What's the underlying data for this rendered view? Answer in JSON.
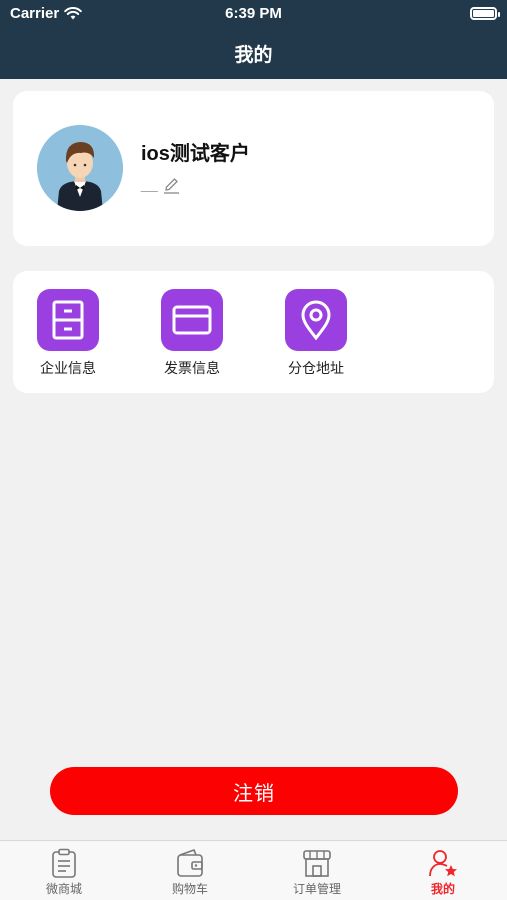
{
  "status_bar": {
    "carrier": "Carrier",
    "time": "6:39 PM"
  },
  "header": {
    "title": "我的"
  },
  "profile": {
    "name": "ios测试客户",
    "subtitle": "__"
  },
  "menu": {
    "items": [
      {
        "label": "企业信息",
        "icon": "cabinet-icon"
      },
      {
        "label": "发票信息",
        "icon": "card-icon"
      },
      {
        "label": "分仓地址",
        "icon": "location-pin-icon"
      }
    ]
  },
  "logout": {
    "label": "注销"
  },
  "tabbar": {
    "items": [
      {
        "label": "微商城",
        "icon": "clipboard-icon"
      },
      {
        "label": "购物车",
        "icon": "wallet-icon"
      },
      {
        "label": "订单管理",
        "icon": "store-icon"
      },
      {
        "label": "我的",
        "icon": "user-star-icon",
        "active": true
      }
    ]
  },
  "colors": {
    "header_bg": "#22394b",
    "accent_purple": "#9a3fe0",
    "logout_red": "#fb0101",
    "active_tab": "#f0272a"
  }
}
